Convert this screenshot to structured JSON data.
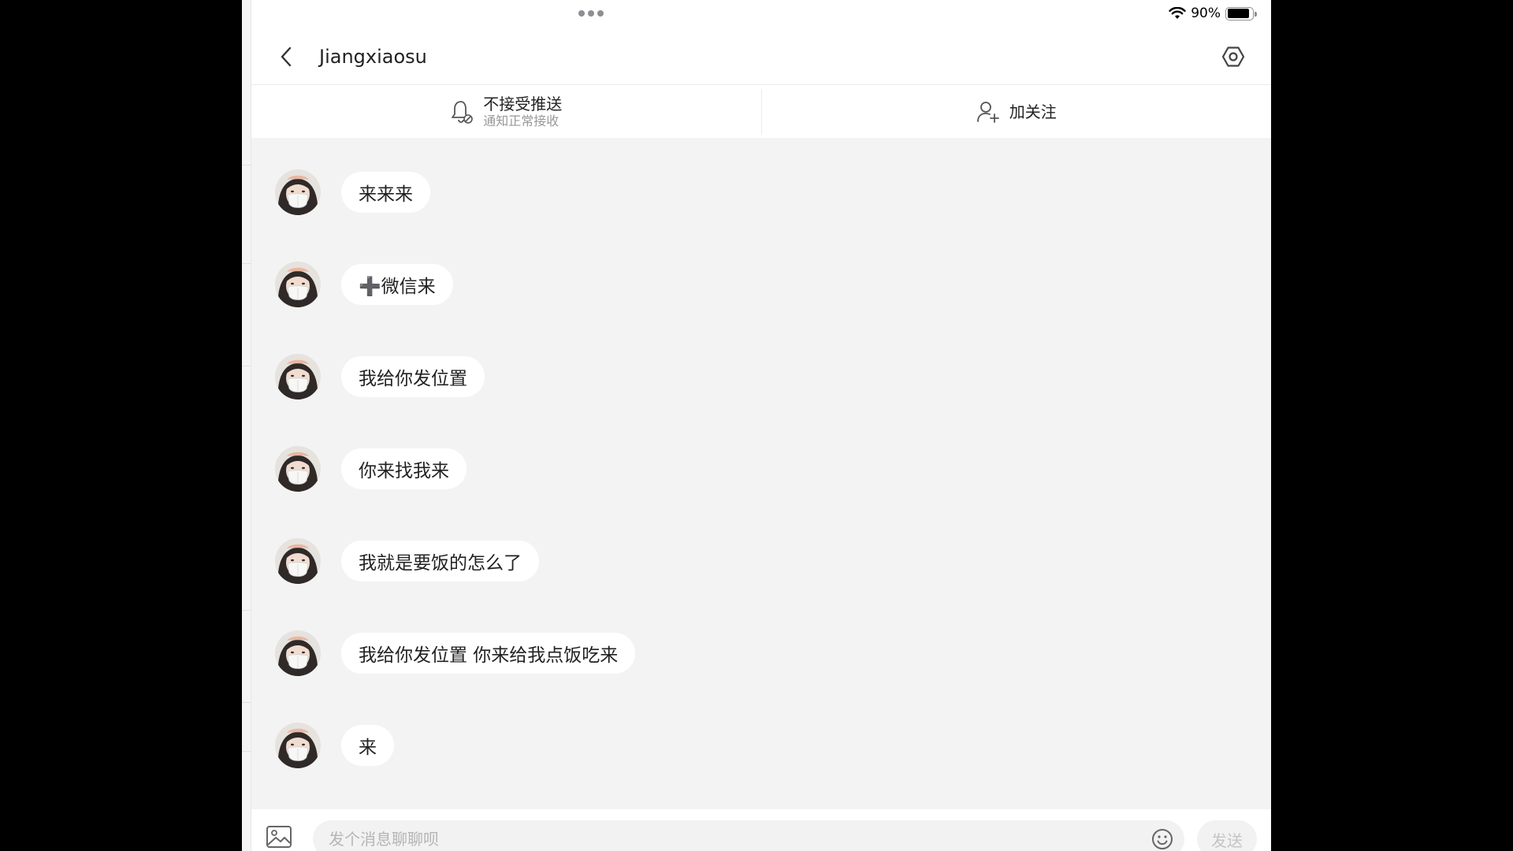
{
  "status_bar": {
    "battery_text": "90%",
    "battery_level": 0.9
  },
  "header": {
    "title": "Jiangxiaosu",
    "back_icon": "chevron-left-icon",
    "settings_icon": "hexagon-gear-icon"
  },
  "actions": {
    "push": {
      "label": "不接受推送",
      "sublabel": "通知正常接收",
      "icon": "bell-off-icon"
    },
    "follow": {
      "label": "加关注",
      "icon": "add-user-icon"
    }
  },
  "messages": [
    {
      "text": "来来来"
    },
    {
      "text": "➕微信来"
    },
    {
      "text": "我给你发位置"
    },
    {
      "text": "你来找我来"
    },
    {
      "text": "我就是要饭的怎么了"
    },
    {
      "text": "我给你发位置 你来给我点饭吃来"
    },
    {
      "text": "来"
    }
  ],
  "input": {
    "placeholder": "发个消息聊聊呗",
    "value": "",
    "send_label": "发送",
    "image_icon": "image-icon",
    "emoji_icon": "emoji-icon"
  },
  "colors": {
    "chat_background": "#f3f3f3",
    "bubble": "#ffffff",
    "text_primary": "#222222",
    "text_secondary": "#999999"
  }
}
